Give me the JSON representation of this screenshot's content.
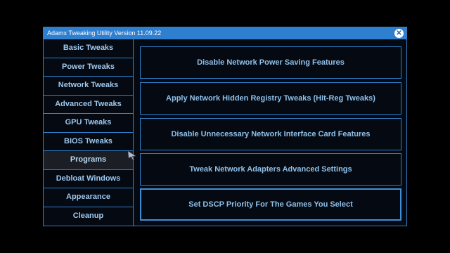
{
  "window": {
    "title": "Adamx Tweaking Utility Version 11.09.22",
    "close_glyph": "✕"
  },
  "sidebar": {
    "items": [
      {
        "label": "Basic Tweaks"
      },
      {
        "label": "Power Tweaks"
      },
      {
        "label": "Network Tweaks"
      },
      {
        "label": "Advanced Tweaks"
      },
      {
        "label": "GPU Tweaks"
      },
      {
        "label": "BIOS Tweaks"
      },
      {
        "label": "Programs"
      },
      {
        "label": "Debloat Windows"
      },
      {
        "label": "Appearance"
      },
      {
        "label": "Cleanup"
      }
    ],
    "active_index": 6
  },
  "actions": [
    {
      "label": "Disable Network Power Saving Features"
    },
    {
      "label": "Apply Network Hidden Registry Tweaks (Hit-Reg Tweaks)"
    },
    {
      "label": "Disable Unnecessary Network Interface Card Features"
    },
    {
      "label": "Tweak Network Adapters Advanced Settings"
    },
    {
      "label": "Set DSCP Priority For The Games You Select"
    }
  ],
  "colors": {
    "accent": "#2f7fc8",
    "titlebar": "#2f7fd0",
    "text": "#9ec9ef",
    "background": "#000000"
  },
  "icons": {
    "close": "close-icon",
    "cursor": "mouse-pointer-icon"
  }
}
